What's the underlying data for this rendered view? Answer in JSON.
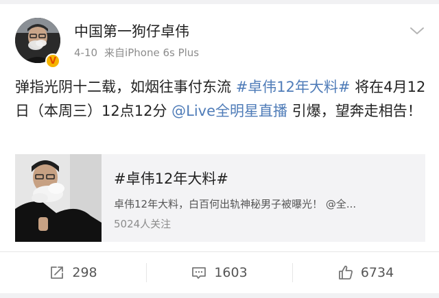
{
  "post": {
    "username": "中国第一狗仔卓伟",
    "date": "4-10",
    "source": "来自iPhone 6s Plus",
    "verified_badge": "V",
    "text": {
      "part1": "弹指光阴十二载，如烟往事付东流 ",
      "hashtag": "#卓伟12年大料#",
      "part2": " 将在4月12日（本周三）12点12分 ",
      "mention": "@Live全明星直播",
      "part3": " 引爆，望奔走相告！"
    }
  },
  "card": {
    "title": "#卓伟12年大料#",
    "description": "卓伟12年大料，白百何出轨神秘男子被曝光！ @全...",
    "followers": "5024人关注"
  },
  "actions": {
    "repost_count": "298",
    "comment_count": "1603",
    "like_count": "6734"
  },
  "colors": {
    "link": "#4f7cb8",
    "text": "#222222",
    "muted": "#8c8c8c",
    "badge": "#f5b400"
  },
  "icons": {
    "repost": "share-arrow-icon",
    "comment": "comment-bubble-icon",
    "like": "thumbs-up-icon",
    "menu": "chevron-down-icon"
  }
}
